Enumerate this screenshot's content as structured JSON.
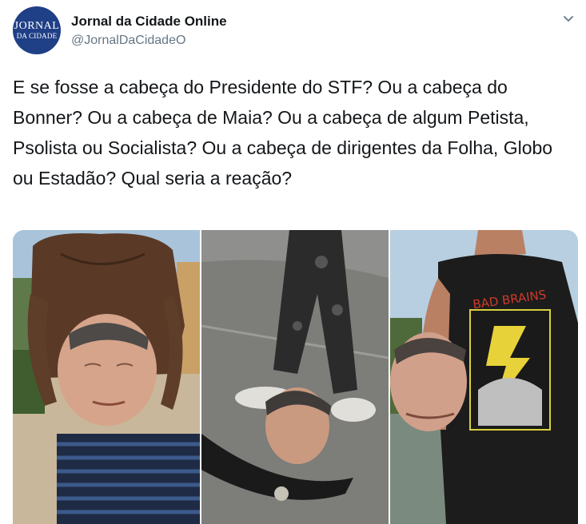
{
  "account": {
    "avatar_line1": "JORNAL",
    "avatar_line2": "DA CIDADE",
    "display_name": "Jornal da Cidade Online",
    "handle": "@JornalDaCidadeO"
  },
  "tweet": {
    "text": "E se fosse a cabeça do Presidente do STF? Ou a cabeça do Bonner? Ou a cabeça de Maia? Ou a cabeça de algum Petista, Psolista ou Socialista? Ou a cabeça de dirigentes da Folha, Globo ou Estadão? Qual seria a reação?"
  },
  "media": {
    "photos": [
      {
        "name": "photo-1"
      },
      {
        "name": "photo-2"
      },
      {
        "name": "photo-3",
        "shirt_text": "BAD BRAINS"
      }
    ]
  },
  "colors": {
    "text": "#14171a",
    "muted": "#657786",
    "avatar_bg": "#1f3f86"
  },
  "icons": {
    "menu": "chevron-down-icon"
  }
}
